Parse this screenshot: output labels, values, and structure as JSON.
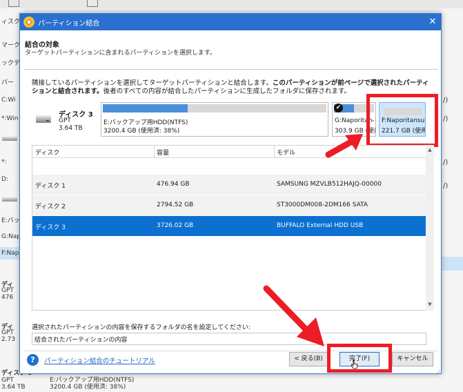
{
  "background": {
    "sidebar_items": [
      "ィスク\\",
      "マーク",
      "ックディ",
      "パー",
      "C:Wi",
      "*:Win",
      "*:",
      "D:",
      "E:バッ",
      "G:Nap",
      "F:Nap",
      "ディ",
      "GPT",
      "476",
      "ディ",
      "GPT",
      "2.73"
    ],
    "right_items": [
      "/)",
      "/)",
      "/)",
      "/)"
    ],
    "disk3": {
      "name": "ディスク 3",
      "type": "GPT",
      "size": "3.64 TB"
    },
    "disk3_partition": {
      "name": "E:バックアップ用HDD(NTFS)",
      "detail": "3200.4 GB (使用済: 38%)"
    }
  },
  "dialog": {
    "title": "パーティション結合",
    "close_label": "✕",
    "header_title": "結合の対象",
    "header_subtitle": "ターゲットパーティションに含まれるパーティションを選択します。",
    "description_normal": "隣接しているパーティションを選択してターゲットパーティションと結合します。",
    "description_bold1": "このパーティションが前ページで選択されたパーティションと結合されます。",
    "description_normal2": "後者のすべての内容が結合したパーティションに生成したフォルダに保存されます。",
    "disk_card": {
      "name": "ディスク 3",
      "type": "GPT",
      "size": "3.64 TB"
    },
    "partitions": [
      {
        "name": "E:バックアップ用HDD(NTFS)",
        "detail": "3200.4 GB (使用済: 38%)",
        "used": 0.38
      },
      {
        "name": "G:Naporitan-",
        "detail": "303.9 GB (使用",
        "used": 0.5,
        "checked": true
      },
      {
        "name": "F:Naporitansu",
        "detail": "221.7 GB (使用",
        "selected": true
      }
    ],
    "check_mark": "✔",
    "table": {
      "headers": [
        "ディスク",
        "容量",
        "モデル"
      ],
      "rows": [
        {
          "disk": "ディスク 1",
          "capacity": "476.94 GB",
          "model": "SAMSUNG MZVLB512HAJQ-00000"
        },
        {
          "disk": "ディスク 2",
          "capacity": "2794.52 GB",
          "model": "ST3000DM008-2DM166 SATA"
        },
        {
          "disk": "ディスク 3",
          "capacity": "3726.02 GB",
          "model": "BUFFALO External HDD USB"
        }
      ],
      "selected_row": 2
    },
    "folder_label": "選択されたパーティションの内容を保存するフォルダの名を設定してください:",
    "folder_value": "結合されたパーティションの内容",
    "help_icon_label": "?",
    "help_link": "パーティション結合のチュートリアル",
    "buttons": {
      "back": "< 戻る(B)",
      "finish": "完了(F)",
      "cancel": "キャンセル"
    }
  },
  "colors": {
    "accent": "#2b6fcf",
    "selection": "#0b70d0",
    "highlight": "#ee1c25",
    "used_bar": "#4a8fd9"
  }
}
